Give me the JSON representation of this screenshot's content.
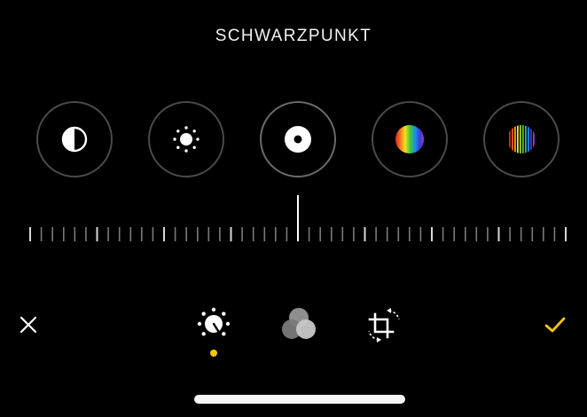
{
  "header": {
    "title": "SCHWARZPUNKT"
  },
  "tools": [
    {
      "name": "contrast-icon",
      "selected": false
    },
    {
      "name": "brightness-icon",
      "selected": false
    },
    {
      "name": "black-point-icon",
      "selected": true
    },
    {
      "name": "saturation-icon",
      "selected": false
    },
    {
      "name": "vibrance-icon",
      "selected": false
    }
  ],
  "adjustment_slider": {
    "value": 0,
    "tick_count": 49
  },
  "bottom_toolbar": {
    "cancel_icon": "close-icon",
    "modes": [
      "adjust-icon",
      "filters-icon",
      "crop-rotate-icon"
    ],
    "active_mode": "adjust-icon",
    "confirm_icon": "checkmark-icon"
  },
  "colors": {
    "background": "#000000",
    "accent": "#F5C518",
    "circle_border": "#4A4A4A",
    "foreground": "#FFFFFF"
  }
}
